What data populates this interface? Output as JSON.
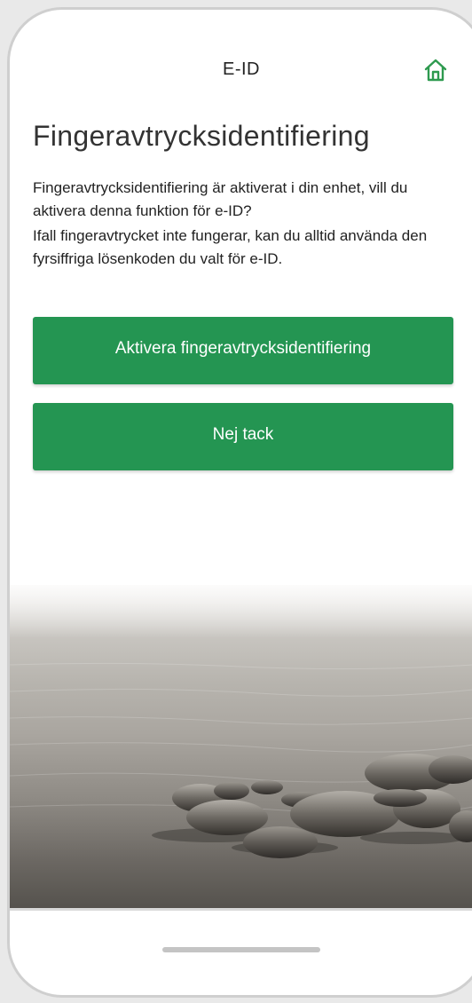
{
  "header": {
    "title": "E-ID",
    "home_icon": "home-icon"
  },
  "main": {
    "title": "Fingeravtrycksidentifiering",
    "paragraph_1": "Fingeravtrycksidentifiering är aktiverat i din enhet, vill du aktivera denna funktion för e-ID?",
    "paragraph_2": "Ifall fingeravtrycket inte fungerar, kan du alltid använda den fyrsiffriga lösenkoden du valt för e-ID."
  },
  "actions": {
    "activate_label": "Aktivera fingeravtrycksidentifiering",
    "decline_label": "Nej tack"
  },
  "colors": {
    "accent": "#249552",
    "home_icon": "#2e9a4f"
  }
}
